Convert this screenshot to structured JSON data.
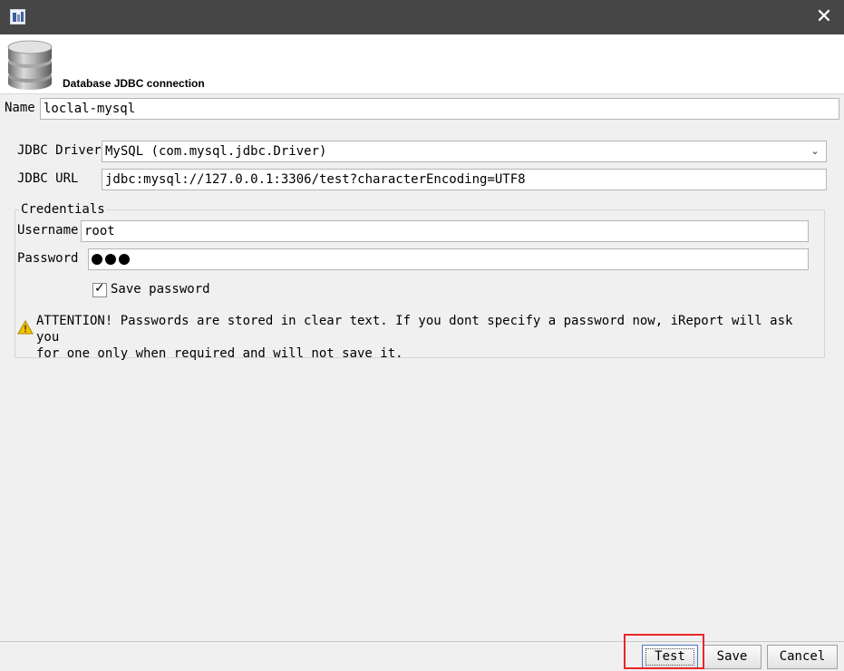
{
  "window": {
    "title_icon": "ireport-app-icon",
    "close_icon": "close-icon"
  },
  "header": {
    "title": "Database JDBC connection",
    "icon": "database-icon"
  },
  "name_field": {
    "label": "Name",
    "value": "loclal-mysql"
  },
  "driver": {
    "label": "JDBC Driver",
    "value": "MySQL (com.mysql.jdbc.Driver)"
  },
  "url": {
    "label": "JDBC URL",
    "value": "jdbc:mysql://127.0.0.1:3306/test?characterEncoding=UTF8"
  },
  "credentials": {
    "legend": "Credentials",
    "username_label": "Username",
    "username_value": "root",
    "password_label": "Password",
    "password_length": 3,
    "save_password_label": "Save password",
    "save_password_checked": true,
    "warning_text": "ATTENTION! Passwords are stored in clear text. If you dont specify a password now, iReport will ask you\nfor one only when required and will not save it."
  },
  "buttons": {
    "test": "Test",
    "save": "Save",
    "cancel": "Cancel"
  },
  "colors": {
    "titlebar": "#464646",
    "highlight": "#e8262b",
    "warning": "#f2c200"
  }
}
